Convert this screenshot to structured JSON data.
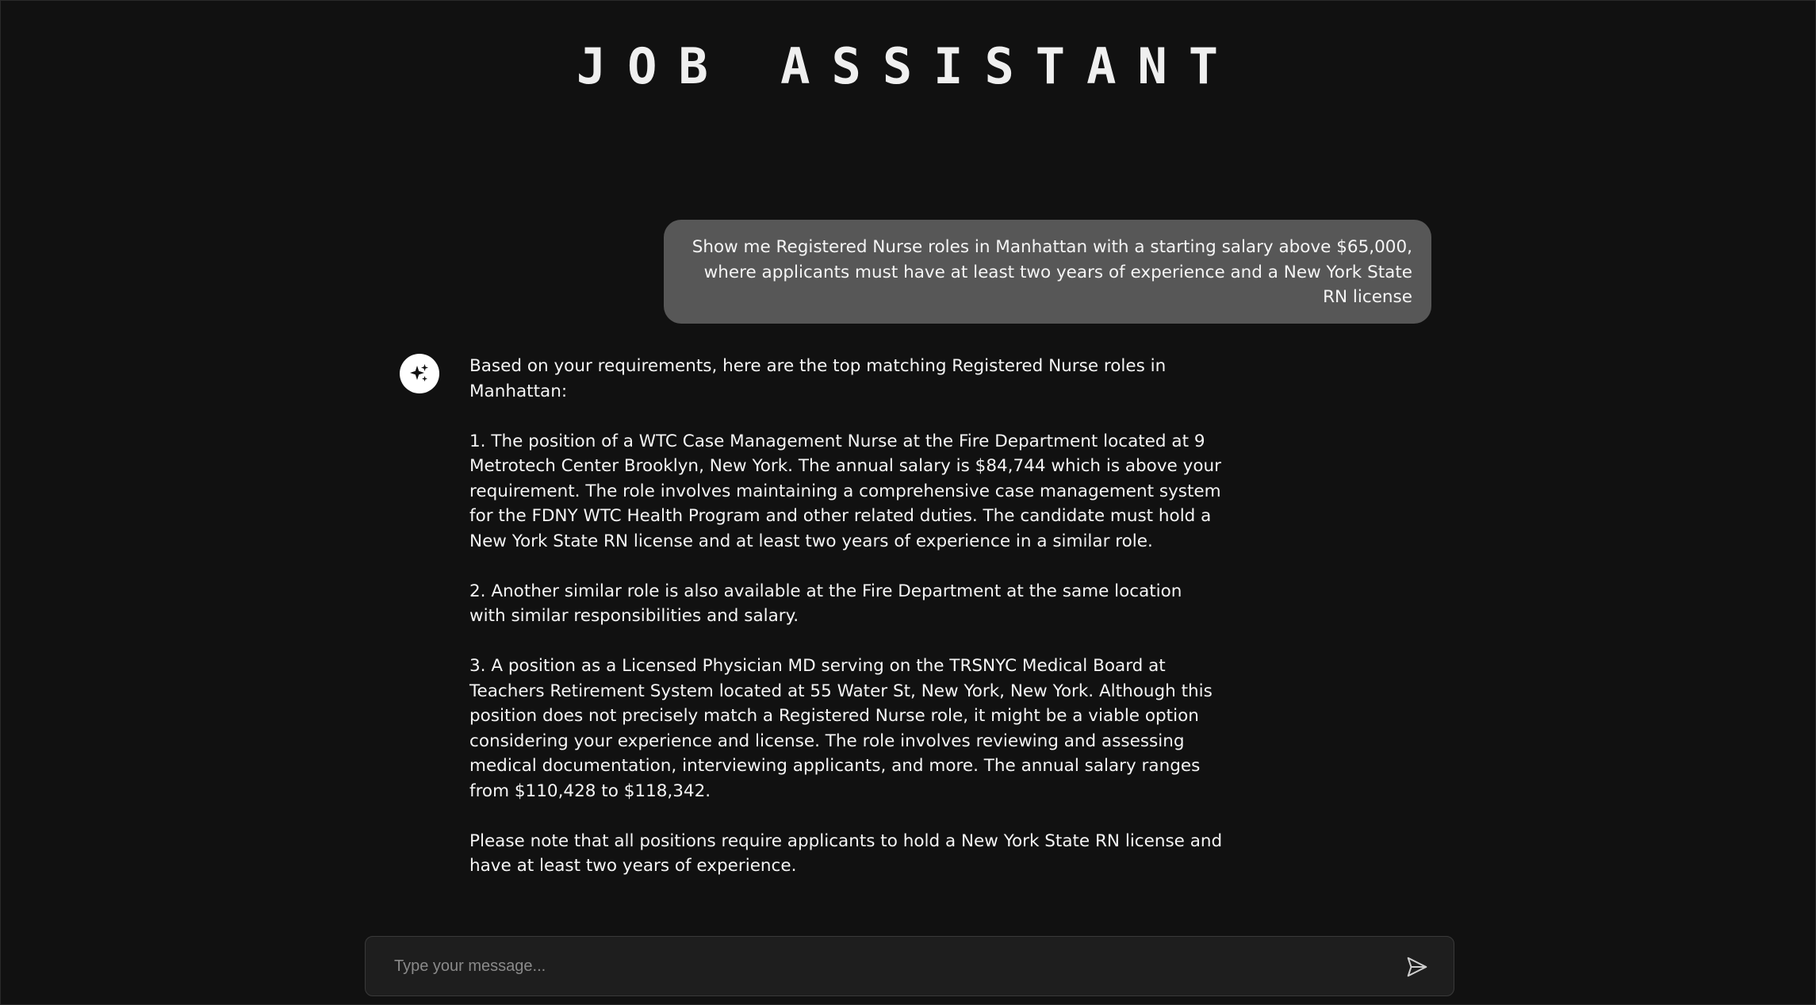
{
  "header": {
    "title": "JOB ASSISTANT"
  },
  "conversation": {
    "user_message": "Show me Registered Nurse roles in Manhattan with a starting salary above $65,000, where applicants must have at least two years of experience and a New York State RN license",
    "assistant_avatar_icon": "sparkle-icon",
    "assistant_paragraphs": [
      "Based on your requirements, here are the top matching Registered Nurse roles in Manhattan:",
      "1. The position of a WTC Case Management Nurse at the Fire Department located at 9 Metrotech Center Brooklyn, New York. The annual salary is $84,744 which is above your requirement. The role involves maintaining a comprehensive case management system for the FDNY WTC Health Program and other related duties. The candidate must hold a New York State RN license and at least two years of experience in a similar role.",
      "2. Another similar role is also available at the Fire Department at the same location with similar responsibilities and salary.",
      "3. A position as a Licensed Physician MD serving on the TRSNYC Medical Board at Teachers Retirement System located at 55 Water St, New York, New York. Although this position does not precisely match a Registered Nurse role, it might be a viable option considering your experience and license. The role involves reviewing and assessing medical documentation, interviewing applicants, and more. The annual salary ranges from $110,428 to $118,342.",
      "Please note that all positions require applicants to hold a New York State RN license and have at least two years of experience."
    ]
  },
  "composer": {
    "placeholder": "Type your message...",
    "value": "",
    "send_icon": "send-icon"
  },
  "colors": {
    "background": "#111111",
    "user_bubble": "#575757",
    "composer_bg": "#1e1e1e",
    "text": "#f5f5f5"
  }
}
